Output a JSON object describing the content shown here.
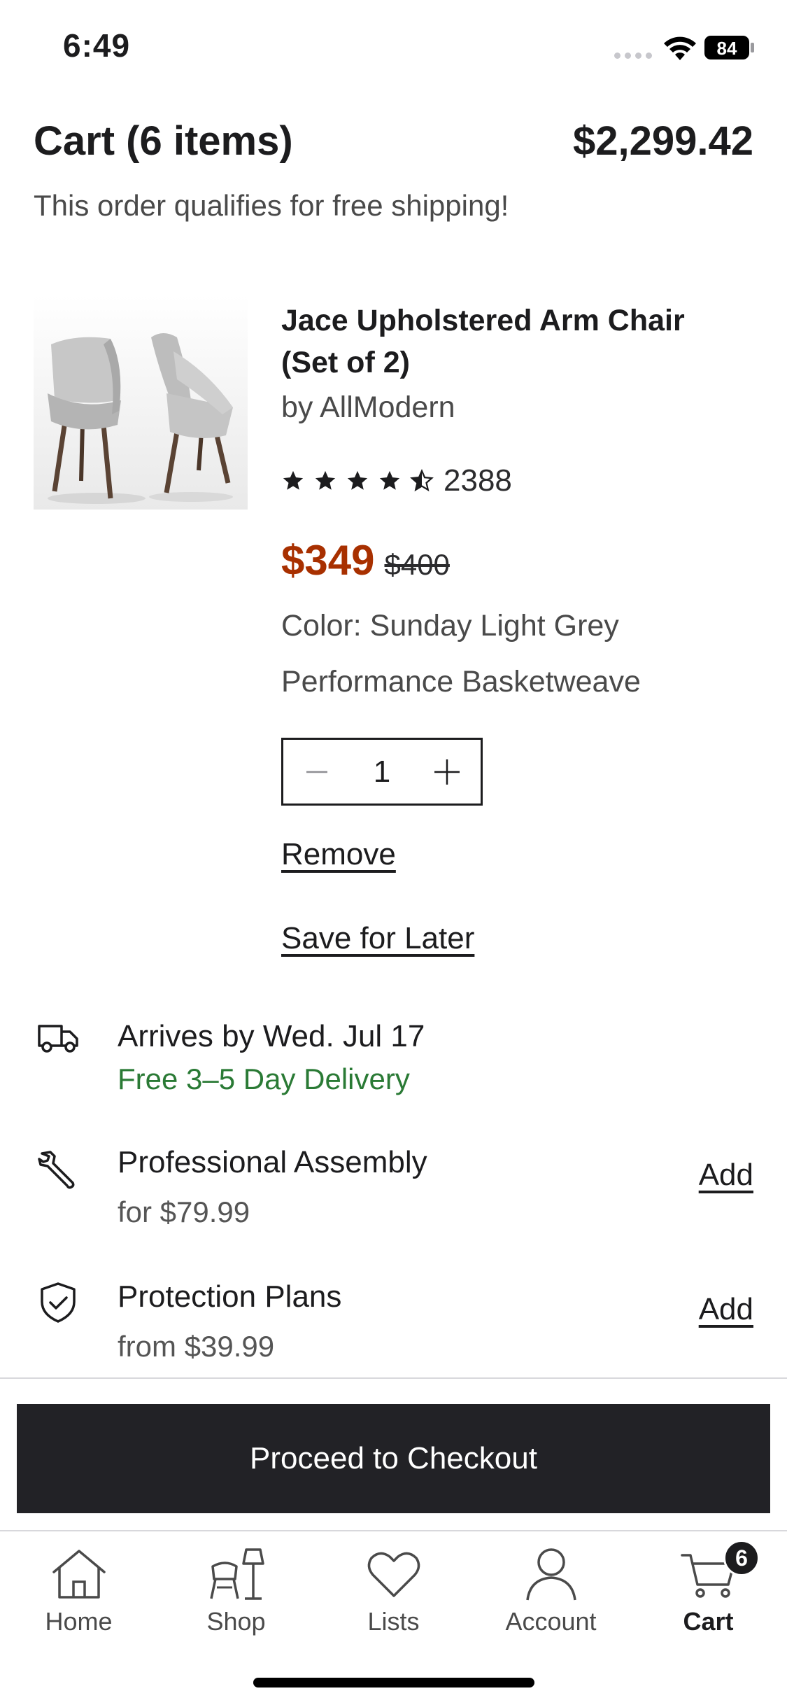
{
  "status_bar": {
    "time": "6:49",
    "battery": "84"
  },
  "cart": {
    "title": "Cart (6 items)",
    "total": "$2,299.42",
    "shipping_note": "This order qualifies for free shipping!"
  },
  "item": {
    "title": "Jace Upholstered Arm Chair (Set of 2)",
    "brand": "by AllModern",
    "rating": 4.5,
    "review_count": "2388",
    "sale_price": "$349",
    "original_price": "$400",
    "option_color": "Color: Sunday Light Grey",
    "option_fabric": "Performance Basketweave",
    "quantity": "1",
    "remove_label": "Remove",
    "save_label": "Save for Later"
  },
  "delivery": {
    "arrival": "Arrives by Wed. Jul 17",
    "method": "Free 3–5 Day Delivery"
  },
  "assembly": {
    "title": "Professional Assembly",
    "price": "for $79.99",
    "action": "Add"
  },
  "protection": {
    "title": "Protection Plans",
    "price": "from $39.99",
    "action": "Add"
  },
  "checkout": {
    "label": "Proceed to Checkout"
  },
  "tabs": [
    {
      "label": "Home",
      "icon": "home-icon"
    },
    {
      "label": "Shop",
      "icon": "shop-icon"
    },
    {
      "label": "Lists",
      "icon": "heart-icon"
    },
    {
      "label": "Account",
      "icon": "account-icon"
    },
    {
      "label": "Cart",
      "icon": "cart-icon",
      "badge": "6",
      "active": true
    }
  ],
  "colors": {
    "sale": "#a83000",
    "delivery": "#2a7a35",
    "checkout_bg": "#222226"
  }
}
